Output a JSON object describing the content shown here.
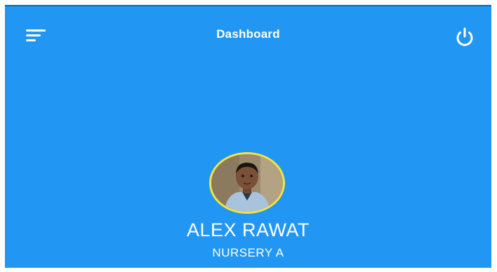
{
  "header": {
    "title": "Dashboard",
    "menu_icon": "menu-sort-icon",
    "power_icon": "power-icon"
  },
  "profile": {
    "name": "ALEX RAWAT",
    "class": "NURSERY A"
  },
  "colors": {
    "background": "#2196f3",
    "top_border": "#1565c0",
    "avatar_ring": "#f7e43a",
    "text": "#ffffff"
  }
}
